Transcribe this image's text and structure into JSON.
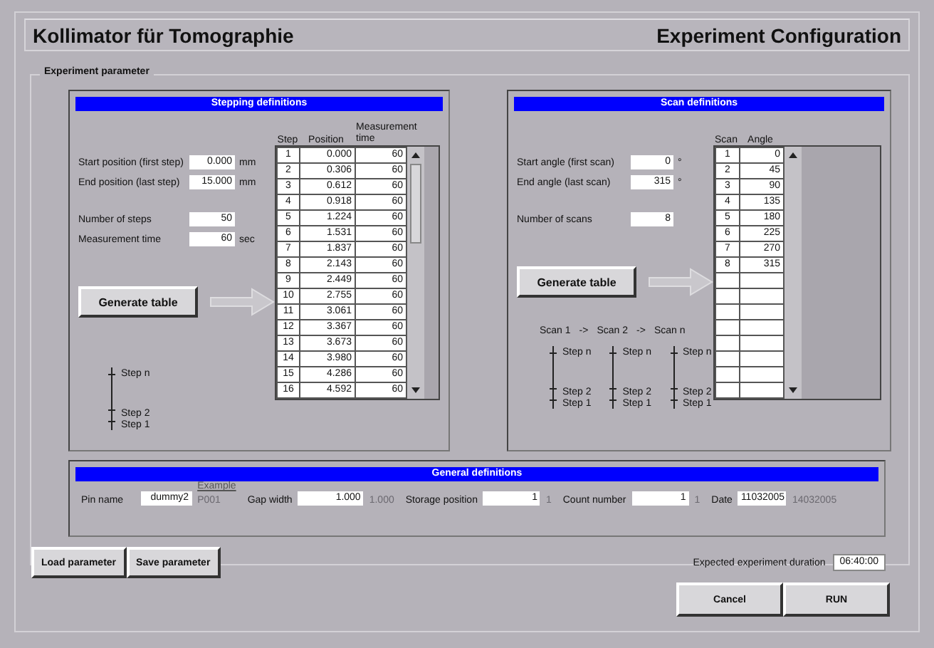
{
  "header": {
    "title": "Kollimator für Tomographie",
    "subtitle": "Experiment Configuration"
  },
  "group_title": "Experiment parameter",
  "stepping": {
    "title": "Stepping definitions",
    "fields": [
      {
        "label": "Start position (first step)",
        "value": "0.000",
        "unit": "mm"
      },
      {
        "label": "End position (last step)",
        "value": "15.000",
        "unit": "mm"
      },
      {
        "label": "Number of steps",
        "value": "50"
      },
      {
        "label": "Measurement time",
        "value": "60",
        "unit": "sec"
      }
    ],
    "button": "Generate table",
    "table": {
      "columns": [
        "Step",
        "Position",
        "Measurement time"
      ],
      "rows": [
        [
          "1",
          "0.000",
          "60"
        ],
        [
          "2",
          "0.306",
          "60"
        ],
        [
          "3",
          "0.612",
          "60"
        ],
        [
          "4",
          "0.918",
          "60"
        ],
        [
          "5",
          "1.224",
          "60"
        ],
        [
          "6",
          "1.531",
          "60"
        ],
        [
          "7",
          "1.837",
          "60"
        ],
        [
          "8",
          "2.143",
          "60"
        ],
        [
          "9",
          "2.449",
          "60"
        ],
        [
          "10",
          "2.755",
          "60"
        ],
        [
          "11",
          "3.061",
          "60"
        ],
        [
          "12",
          "3.367",
          "60"
        ],
        [
          "13",
          "3.673",
          "60"
        ],
        [
          "14",
          "3.980",
          "60"
        ],
        [
          "15",
          "4.286",
          "60"
        ],
        [
          "16",
          "4.592",
          "60"
        ]
      ]
    },
    "diagram": [
      {
        "labels": [
          "Step n",
          "Step 2",
          "Step 1"
        ]
      }
    ]
  },
  "scan": {
    "title": "Scan definitions",
    "fields": [
      {
        "label": "Start angle (first scan)",
        "value": "0",
        "unit": "°"
      },
      {
        "label": "End angle (last scan)",
        "value": "315",
        "unit": "°"
      },
      {
        "label": "Number of scans",
        "value": "8"
      }
    ],
    "button": "Generate table",
    "table": {
      "columns": [
        "Scan",
        "Angle"
      ],
      "rows": [
        [
          "1",
          "0"
        ],
        [
          "2",
          "45"
        ],
        [
          "3",
          "90"
        ],
        [
          "4",
          "135"
        ],
        [
          "5",
          "180"
        ],
        [
          "6",
          "225"
        ],
        [
          "7",
          "270"
        ],
        [
          "8",
          "315"
        ]
      ]
    },
    "diagram_caption": [
      "Scan 1",
      "->",
      "Scan 2",
      "->",
      "Scan n"
    ],
    "diagram": [
      {
        "labels": [
          "Step n",
          "Step 2",
          "Step 1"
        ]
      },
      {
        "labels": [
          "Step n",
          "Step 2",
          "Step 1"
        ]
      },
      {
        "labels": [
          "Step n",
          "Step 2",
          "Step 1"
        ]
      }
    ]
  },
  "general": {
    "title": "General definitions",
    "example_label": "Example",
    "fields": [
      {
        "label": "Pin name",
        "value": "dummy2",
        "example": "P001"
      },
      {
        "label": "Gap width",
        "value": "1.000",
        "example": "1.000"
      },
      {
        "label": "Storage position",
        "value": "1",
        "example": "1"
      },
      {
        "label": "Count number",
        "value": "1",
        "example": "1"
      },
      {
        "label": "Date",
        "value": "11032005",
        "example": "14032005"
      }
    ]
  },
  "file_buttons": [
    "Load parameter",
    "Save parameter"
  ],
  "duration": {
    "label": "Expected experiment duration",
    "value": "06:40:00"
  },
  "actions": [
    "Cancel",
    "RUN"
  ]
}
